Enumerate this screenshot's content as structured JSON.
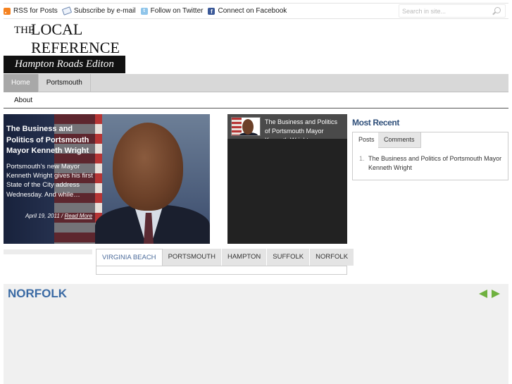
{
  "topbar": {
    "rss": "RSS for Posts",
    "email": "Subscribe by e-mail",
    "twitter": "Follow on Twitter",
    "facebook": "Connect on Facebook",
    "search_placeholder": "Search in site..."
  },
  "logo": {
    "the": "THE",
    "local": "LOCAL",
    "reference": "REFERENCE",
    "edition": "Hampton Roads Editon"
  },
  "nav": {
    "items": [
      "Home",
      "Portsmouth"
    ],
    "active": "Home",
    "sub_items": [
      "About"
    ]
  },
  "featured": {
    "title": "The Business and Politics of Portsmouth Mayor Kenneth Wright",
    "excerpt": "Portsmouth's new Mayor Kenneth Wright gives his first State of the City address Wednesday. And while…",
    "date": "April 19, 2011",
    "separator": " / ",
    "read_more": "Read More"
  },
  "thumb": {
    "title": "The Business and Politics of Portsmouth Mayor Kenneth Wright"
  },
  "most_recent": {
    "title": "Most Recent",
    "tabs": [
      "Posts",
      "Comments"
    ],
    "items": [
      {
        "num": "1.",
        "text": "The Business and Politics of Portsmouth Mayor Kenneth Wright"
      }
    ]
  },
  "category_tabs": [
    "VIRGINIA BEACH",
    "PORTSMOUTH",
    "HAMPTON",
    "SUFFOLK",
    "NORFOLK"
  ],
  "section": {
    "title": "NORFOLK"
  },
  "colors": {
    "link_blue": "#2f4f7a",
    "section_blue": "#3a6aa4",
    "arrow_green": "#6fb13f",
    "nav_gray": "#d8d8d8"
  },
  "icons": [
    "rss-icon",
    "email-icon",
    "twitter-icon",
    "facebook-icon",
    "search-icon",
    "prev-arrow-icon",
    "next-arrow-icon"
  ]
}
